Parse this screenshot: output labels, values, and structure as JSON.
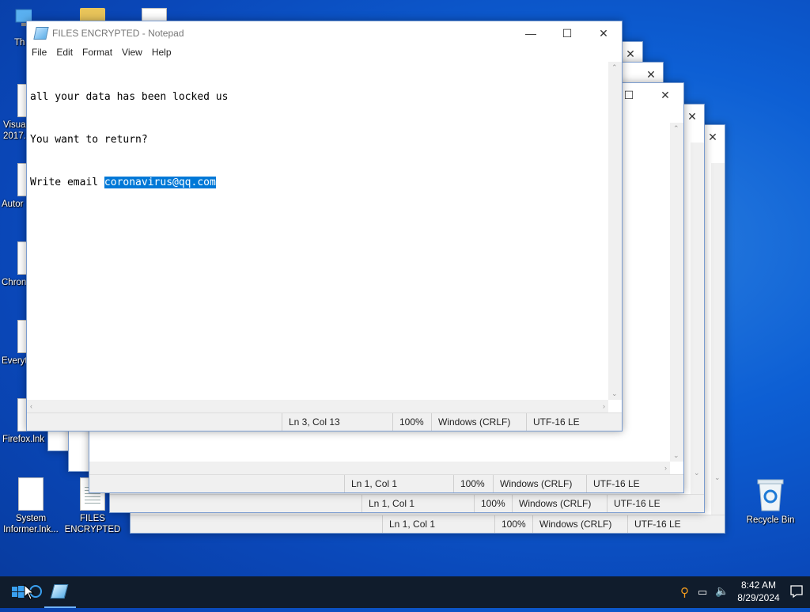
{
  "desktop": {
    "icons_left": [
      {
        "label": "Th"
      },
      {
        "label": "Visua 2017.l"
      },
      {
        "label": "Autor"
      },
      {
        "label": "Chron"
      },
      {
        "label": "Everyt"
      },
      {
        "label": "Firefox.lnk"
      },
      {
        "label": "System Informer.lnk..."
      },
      {
        "label": "FILES ENCRYPTED"
      }
    ],
    "recycle_bin": {
      "label": "Recycle Bin"
    }
  },
  "notepad": {
    "title": "FILES ENCRYPTED - Notepad",
    "menu": [
      "File",
      "Edit",
      "Format",
      "View",
      "Help"
    ],
    "lines": [
      "all your data has been locked us",
      "You want to return?",
      "Write email "
    ],
    "selected_email": "coronavirus@qq.com",
    "status": {
      "position": "Ln 3, Col 13",
      "zoom": "100%",
      "eol": "Windows (CRLF)",
      "encoding": "UTF-16 LE"
    }
  },
  "background_windows": [
    {
      "status": {
        "position": "Ln 1, Col 1",
        "zoom": "100%",
        "eol": "Windows (CRLF)",
        "encoding": "UTF-16 LE"
      }
    },
    {
      "status": {
        "position": "Ln 1, Col 1",
        "zoom": "100%",
        "eol": "Windows (CRLF)",
        "encoding": "UTF-16 LE"
      }
    },
    {
      "status": {
        "position": "Ln 1, Col 1",
        "zoom": "100%",
        "eol": "Windows (CRLF)",
        "encoding": "UTF-16 LE"
      }
    }
  ],
  "taskbar": {
    "time": "8:42 AM",
    "date": "8/29/2024"
  },
  "icons": {
    "minimize": "minimize-icon",
    "maximize": "maximize-icon",
    "close": "close-icon",
    "start": "windows-logo-icon",
    "search": "cortana-icon",
    "notepad_app": "notepad-icon",
    "notifications": "action-center-icon"
  },
  "colors": {
    "selection": "#0078d7",
    "desktop": "#0a47b8",
    "taskbar": "#101c2c"
  }
}
